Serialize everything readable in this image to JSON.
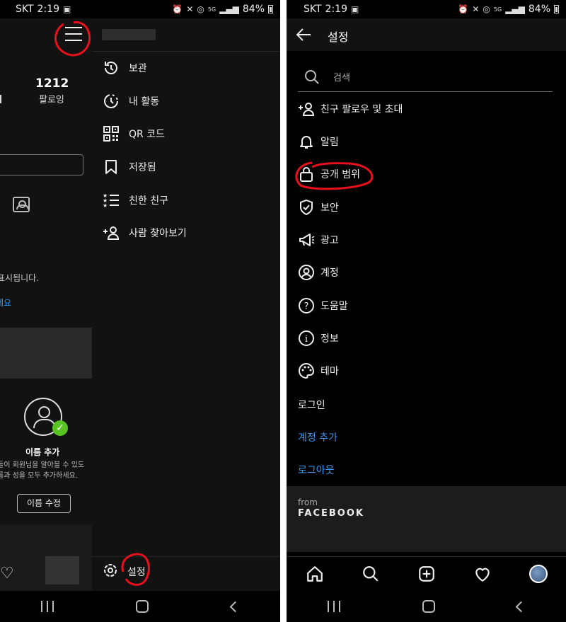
{
  "status_bar": {
    "carrier": "SKT",
    "time": "2:19",
    "signal_label": "5G",
    "battery": "84%"
  },
  "left_screen": {
    "profile": {
      "following_count": "1212",
      "following_label": "팔로잉",
      "empty_text": "표시됩니다.",
      "link_text": "세요",
      "name_card": {
        "title": "이름 추가",
        "desc_line1": "들이 회원님을 알아볼 수 있도",
        "desc_line2": "름과 성을 모두 추가하세요.",
        "button": "이름 수정"
      }
    },
    "drawer": {
      "items": [
        {
          "label": "보관",
          "icon": "archive-icon"
        },
        {
          "label": "내 활동",
          "icon": "activity-icon"
        },
        {
          "label": "QR 코드",
          "icon": "qr-code-icon"
        },
        {
          "label": "저장됨",
          "icon": "bookmark-icon"
        },
        {
          "label": "친한 친구",
          "icon": "close-friends-icon"
        },
        {
          "label": "사람 찾아보기",
          "icon": "add-person-icon"
        }
      ],
      "settings_label": "설정"
    }
  },
  "right_screen": {
    "title": "설정",
    "search_placeholder": "검색",
    "items": [
      {
        "label": "친구 팔로우 및 초대",
        "icon": "add-person-icon"
      },
      {
        "label": "알림",
        "icon": "bell-icon"
      },
      {
        "label": "공개 범위",
        "icon": "lock-icon"
      },
      {
        "label": "보안",
        "icon": "shield-icon"
      },
      {
        "label": "광고",
        "icon": "megaphone-icon"
      },
      {
        "label": "계정",
        "icon": "account-icon"
      },
      {
        "label": "도움말",
        "icon": "help-icon"
      },
      {
        "label": "정보",
        "icon": "info-icon"
      },
      {
        "label": "테마",
        "icon": "palette-icon"
      }
    ],
    "login_label": "로그인",
    "add_account_label": "계정 추가",
    "logout_label": "로그아웃",
    "from_label": "from",
    "facebook_label": "FACEBOOK"
  },
  "colors": {
    "background": "#000000",
    "surface": "#121212",
    "link_blue": "#3897f0",
    "annotation_red": "#e8101c",
    "check_green": "#58c322"
  }
}
